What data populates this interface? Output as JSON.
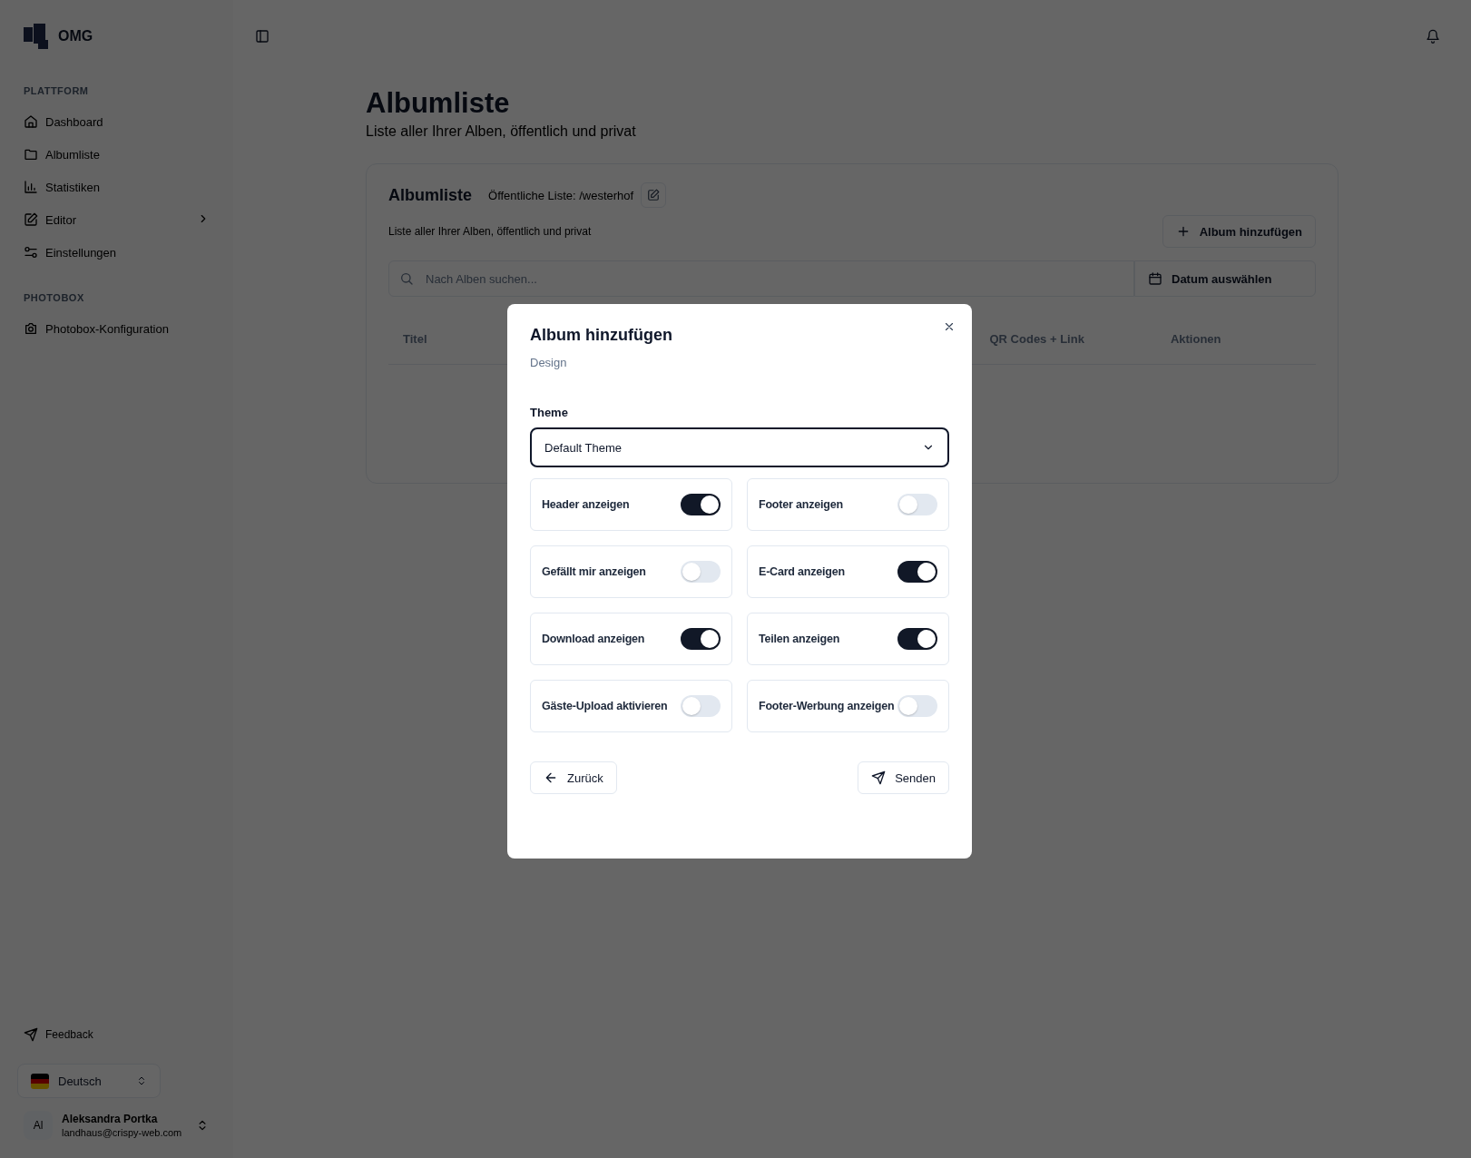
{
  "sidebar": {
    "brand": "OMG",
    "groups": [
      {
        "label": "PLATTFORM",
        "items": [
          {
            "label": "Dashboard",
            "chevron": false
          },
          {
            "label": "Albumliste",
            "chevron": false
          },
          {
            "label": "Statistiken",
            "chevron": false
          },
          {
            "label": "Editor",
            "chevron": true
          },
          {
            "label": "Einstellungen",
            "chevron": false
          }
        ]
      },
      {
        "label": "PHOTOBOX",
        "items": [
          {
            "label": "Photobox-Konfiguration",
            "chevron": false
          }
        ]
      }
    ],
    "feedback": "Feedback",
    "language": "Deutsch",
    "user": {
      "initials": "Al",
      "name": "Aleksandra Portka",
      "email": "landhaus@crispy-web.com"
    }
  },
  "page": {
    "title": "Albumliste",
    "subtitle": "Liste aller Ihrer Alben, öffentlich und privat"
  },
  "card": {
    "title": "Albumliste",
    "public_list": "Öffentliche Liste: /westerhof",
    "description": "Liste aller Ihrer Alben, öffentlich und privat",
    "add_button": "Album hinzufügen",
    "search": {
      "placeholder": "Nach Alben suchen..."
    },
    "date_button": "Datum auswählen",
    "columns": [
      "Titel",
      "QR Codes + Link",
      "Aktionen"
    ]
  },
  "dialog": {
    "title": "Album hinzufügen",
    "step": "Design",
    "theme_label": "Theme",
    "theme_value": "Default Theme",
    "toggles": [
      {
        "label": "Header anzeigen",
        "on": true
      },
      {
        "label": "Footer anzeigen",
        "on": false
      },
      {
        "label": "Gefällt mir anzeigen",
        "on": false
      },
      {
        "label": "E-Card anzeigen",
        "on": true
      },
      {
        "label": "Download anzeigen",
        "on": true
      },
      {
        "label": "Teilen anzeigen",
        "on": true
      },
      {
        "label": "Gäste-Upload aktivieren",
        "on": false
      },
      {
        "label": "Footer-Werbung anzeigen",
        "on": false
      }
    ],
    "back_button": "Zurück",
    "submit_button": "Senden"
  }
}
